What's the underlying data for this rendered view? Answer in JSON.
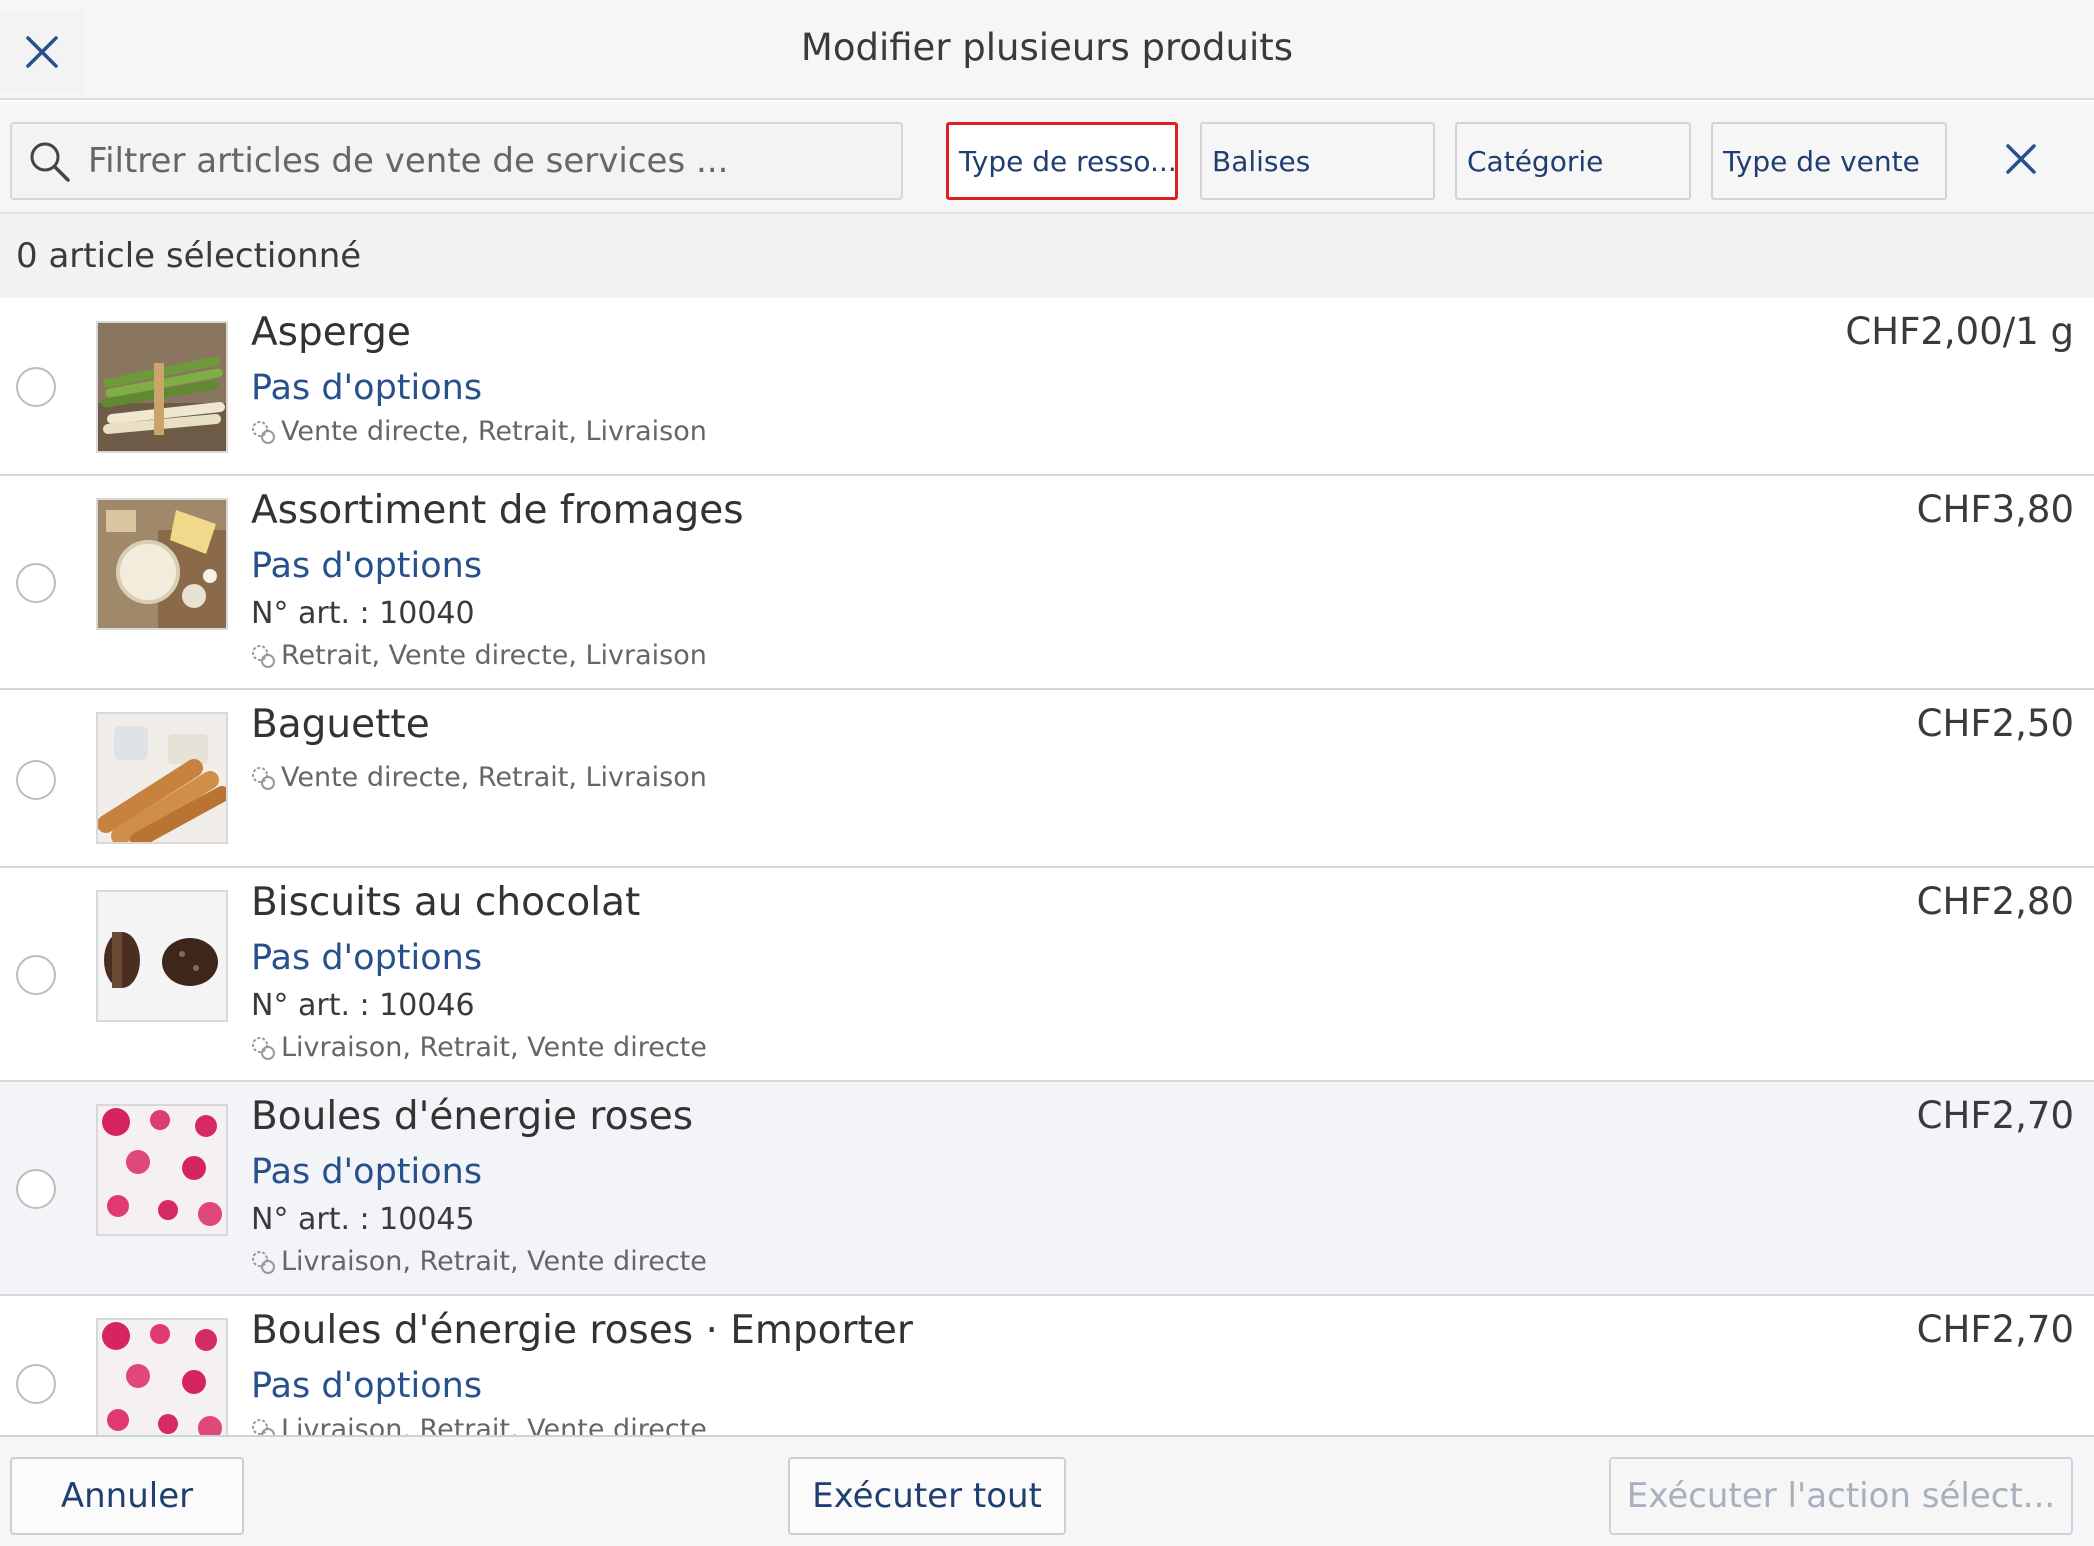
{
  "header": {
    "title": "Modifier plusieurs produits",
    "close_icon": "close-icon"
  },
  "filters": {
    "search_placeholder": "Filtrer articles de vente de services ...",
    "search_value": "",
    "chips": [
      {
        "label": "Type de resso...",
        "active": true
      },
      {
        "label": "Balises",
        "active": false
      },
      {
        "label": "Catégorie",
        "active": false
      },
      {
        "label": "Type de vente",
        "active": false
      }
    ],
    "clear_icon": "close-icon"
  },
  "selection": {
    "count_label": "0 article sélectionné"
  },
  "products": [
    {
      "name": "Asperge",
      "options": "Pas d'options",
      "article_no": "",
      "sale_types": "Vente directe, Retrait, Livraison",
      "price": "CHF2,00/1 g",
      "image": "asparagus"
    },
    {
      "name": "Assortiment de fromages",
      "options": "Pas d'options",
      "article_no": "N° art. : 10040",
      "sale_types": "Retrait, Vente directe, Livraison",
      "price": "CHF3,80",
      "image": "cheese"
    },
    {
      "name": "Baguette",
      "options": "",
      "article_no": "",
      "sale_types": "Vente directe, Retrait, Livraison",
      "price": "CHF2,50",
      "image": "baguette"
    },
    {
      "name": "Biscuits au chocolat",
      "options": "Pas d'options",
      "article_no": "N° art. : 10046",
      "sale_types": "Livraison, Retrait, Vente directe",
      "price": "CHF2,80",
      "image": "chocolate-biscuits"
    },
    {
      "name": "Boules d'énergie roses",
      "options": "Pas d'options",
      "article_no": "N° art. : 10045",
      "sale_types": "Livraison, Retrait, Vente directe",
      "price": "CHF2,70",
      "image": "pink-energy-balls"
    },
    {
      "name": "Boules d'énergie roses · Emporter",
      "options": "Pas d'options",
      "article_no": "",
      "sale_types": "Livraison, Retrait, Vente directe",
      "price": "CHF2,70",
      "image": "pink-energy-balls"
    }
  ],
  "footer": {
    "cancel_label": "Annuler",
    "execute_all_label": "Exécuter tout",
    "execute_selected_label": "Exécuter l'action sélect..."
  },
  "colors": {
    "accent": "#1f3f70",
    "options_link": "#27508c",
    "active_filter_border": "#e02020",
    "highlight_row": "#f2f4f7"
  }
}
